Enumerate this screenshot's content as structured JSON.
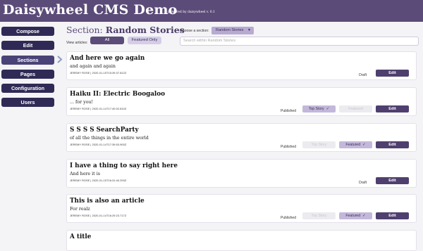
{
  "app": {
    "title": "Daisywheel CMS Demo",
    "powered": "powered by daisywheel v. 0.1"
  },
  "nav": {
    "items": [
      {
        "label": "Compose",
        "active": false
      },
      {
        "label": "Edit",
        "active": false
      },
      {
        "label": "Sections",
        "active": true
      },
      {
        "label": "Pages",
        "active": false
      },
      {
        "label": "Configuration",
        "active": false
      },
      {
        "label": "Users",
        "active": false
      }
    ]
  },
  "section": {
    "title_prefix": "Section: ",
    "title_name": "Random Stories",
    "choose_label": "Choose a section:",
    "choose_value": "Random Stories",
    "view_label": "View articles:",
    "view_all": "All",
    "view_featured": "Featured Only",
    "search_placeholder": "Search within Random Stories"
  },
  "pill_labels": {
    "top_story": "Top Story",
    "featured": "Featured",
    "edit": "Edit",
    "check": "✓"
  },
  "articles": [
    {
      "title": "And here we go again",
      "subtitle": "and again and again",
      "meta": "JEREMY ROSE  |  2020-01-15T15:39:37.812Z",
      "status": "Draft",
      "top_story": null,
      "featured": null
    },
    {
      "title": "Haiku II: Electric Boogaloo",
      "subtitle": "... for you!",
      "meta": "JEREMY ROSE  |  2020-01-14T17:40:02.810Z",
      "status": "Published",
      "top_story": true,
      "featured": false
    },
    {
      "title": "S S S S SearchParty",
      "subtitle": "of all the things in the entire world",
      "meta": "JEREMY ROSE  |  2020-01-14T17:39:53.900Z",
      "status": "Published",
      "top_story": false,
      "featured": true
    },
    {
      "title": "I have a thing to say right here",
      "subtitle": "And here it is",
      "meta": "JEREMY ROSE  |  2020-01-15T16:31:40.293Z",
      "status": "Draft",
      "top_story": null,
      "featured": null
    },
    {
      "title": "This is also an article",
      "subtitle": "For realz",
      "meta": "JEREMY ROSE  |  2020-01-14T16:29:23.717Z",
      "status": "Published",
      "top_story": false,
      "featured": true
    },
    {
      "title": "A title",
      "subtitle": "",
      "meta": "",
      "status": "",
      "top_story": null,
      "featured": null
    }
  ]
}
